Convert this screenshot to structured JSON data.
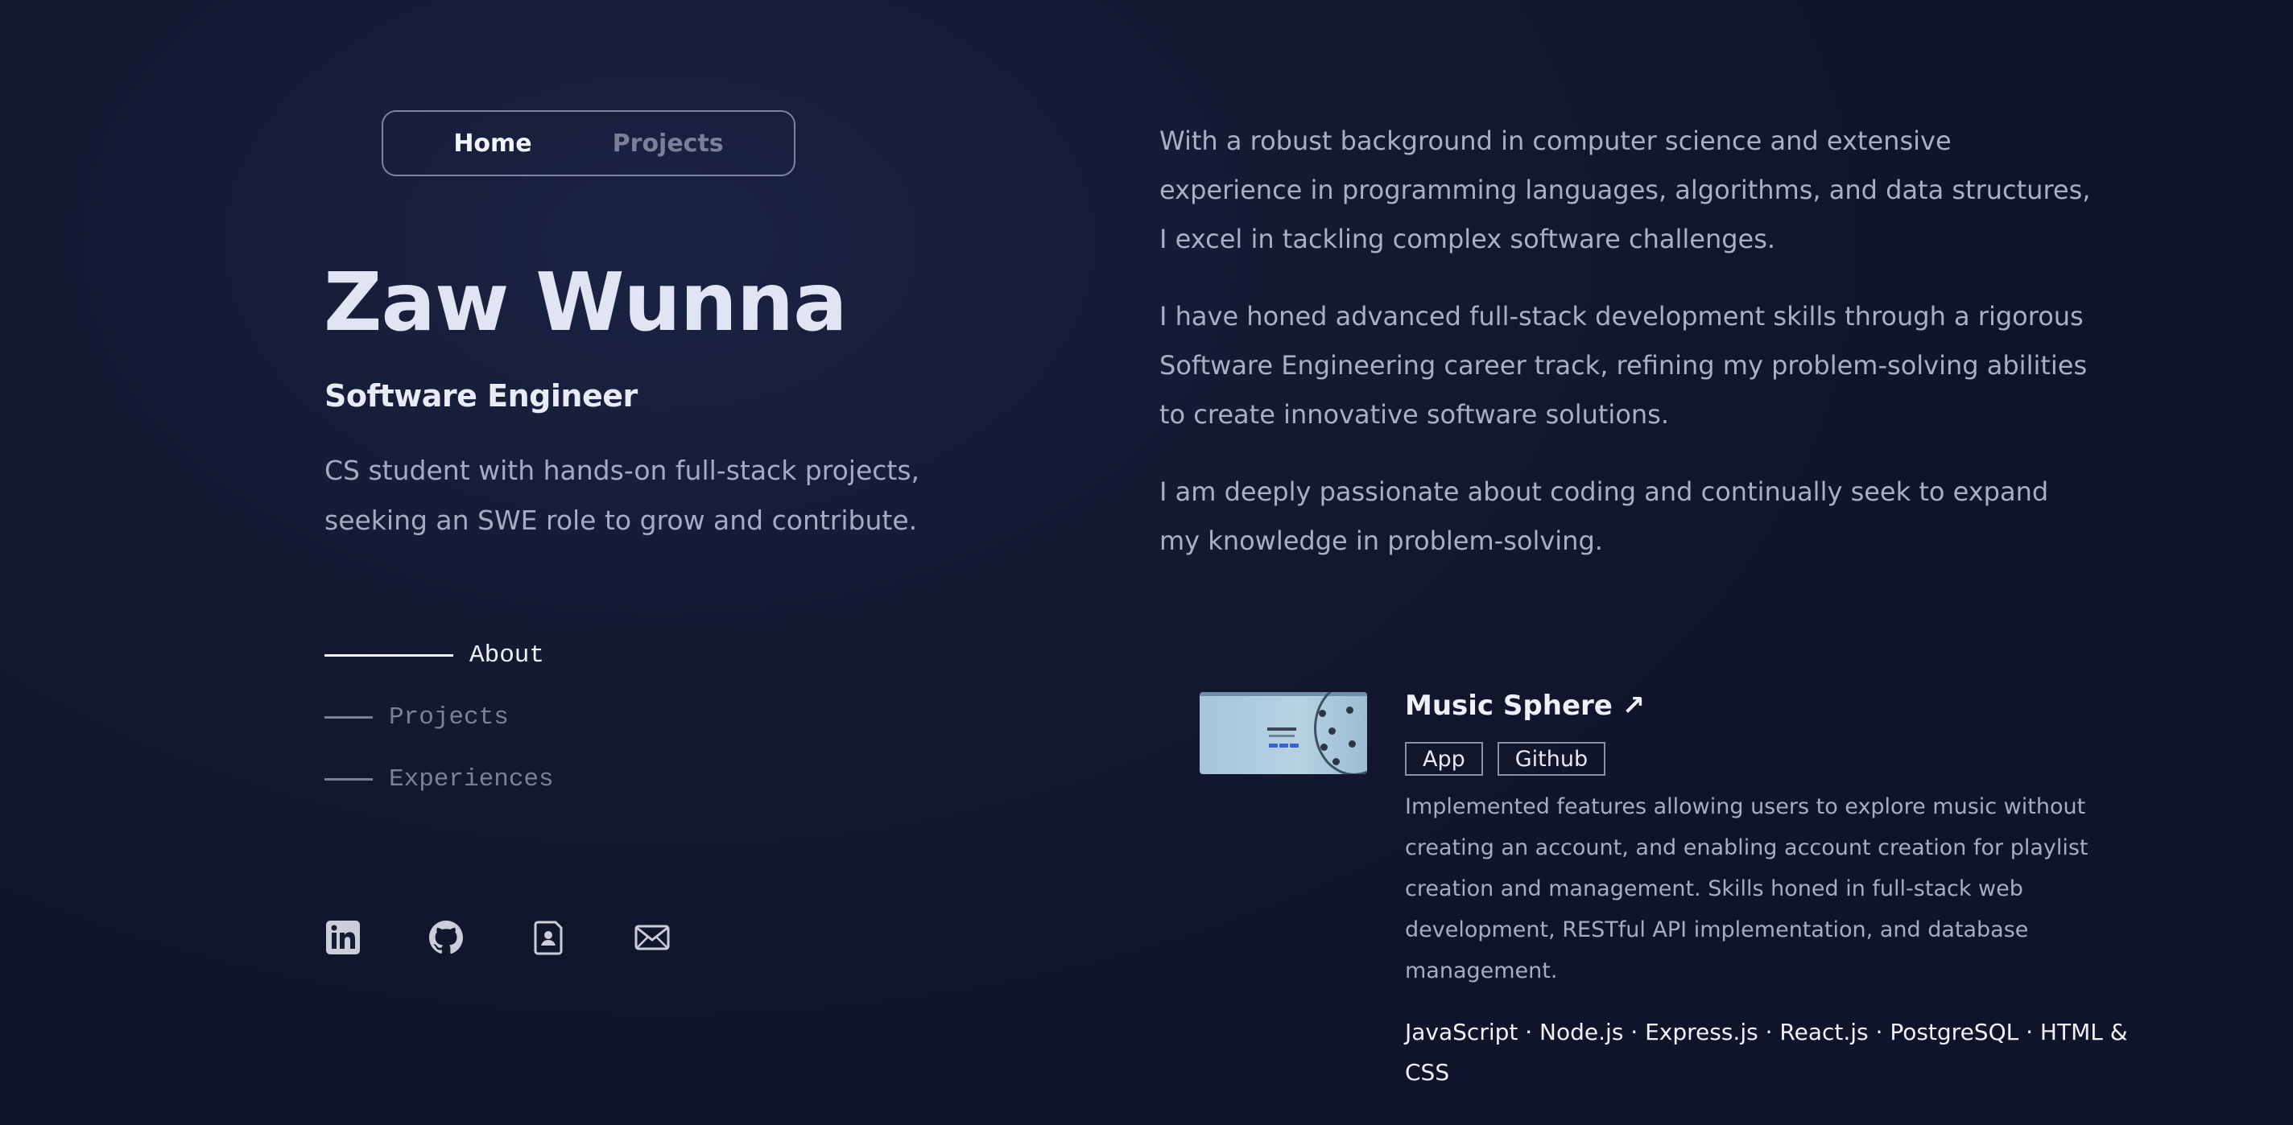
{
  "nav": {
    "tabs": [
      {
        "label": "Home",
        "active": true
      },
      {
        "label": "Projects",
        "active": false
      }
    ]
  },
  "hero": {
    "name": "Zaw Wunna",
    "role": "Software Engineer",
    "summary_lines": [
      "CS student with hands-on full-stack projects,",
      "seeking an SWE role to grow and contribute."
    ]
  },
  "section_nav": {
    "items": [
      {
        "label": "About",
        "active": true
      },
      {
        "label": "Projects",
        "active": false
      },
      {
        "label": "Experiences",
        "active": false
      }
    ]
  },
  "socials": {
    "icons": [
      "linkedin-icon",
      "github-icon",
      "resume-icon",
      "email-icon"
    ]
  },
  "about": {
    "paragraphs": [
      [
        "With a robust background in computer science and extensive",
        "experience in programming languages, algorithms, and data structures,",
        "I excel in tackling complex software challenges."
      ],
      [
        "I have honed advanced full-stack development skills through a rigorous",
        "Software Engineering career track, refining my problem-solving abilities",
        "to create innovative software solutions."
      ],
      [
        "I am deeply passionate about coding and continually seek to expand",
        "my knowledge in problem-solving."
      ]
    ]
  },
  "project": {
    "title": "Music Sphere ↗",
    "links": [
      "App",
      "Github"
    ],
    "thumbnail_text": "Music Sphere",
    "description_lines": [
      "Implemented features allowing users to explore music without",
      "creating an account, and enabling account creation for playlist",
      "creation and management. Skills honed in full-stack web",
      "development, RESTful API implementation, and database",
      "management."
    ],
    "tech_lines": [
      "JavaScript · Node.js · Express.js · React.js · PostgreSQL · HTML &",
      "CSS"
    ]
  },
  "colors": {
    "background": "#141a32",
    "text_primary": "#e1e5f3",
    "text_muted": "#a4abc2",
    "nav_inactive": "#7b8099"
  }
}
